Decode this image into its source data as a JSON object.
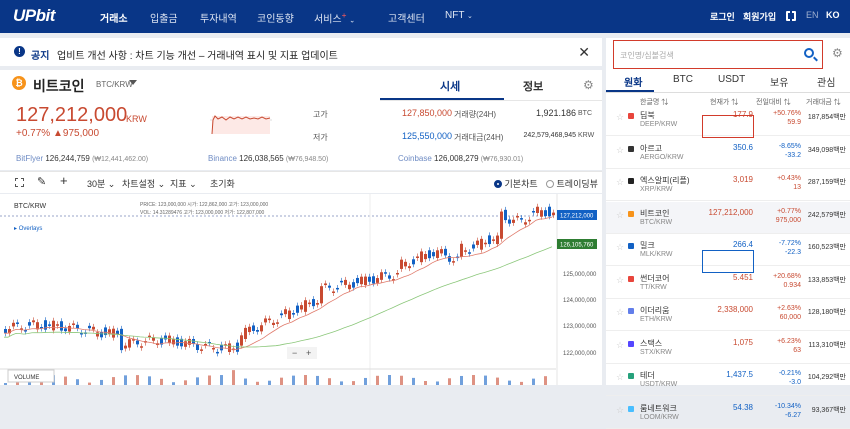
{
  "header": {
    "logo": "UPbit",
    "nav": [
      "거래소",
      "입출금",
      "투자내역",
      "코인동향",
      "서비스",
      "고객센터",
      "NFT"
    ],
    "service_plus": "+",
    "login": "로그인",
    "signup": "회원가입",
    "lang_en": "EN",
    "lang_ko": "KO"
  },
  "notice": {
    "label": "공지",
    "text": "업비트 개선 사항 : 차트 기능 개선 – 거래내역 표시 및 지표 업데이트"
  },
  "coin": {
    "name": "비트코인",
    "pair": "BTC/KRW",
    "tab_price": "시세",
    "tab_info": "정보",
    "price": "127,212,000",
    "unit": "KRW",
    "change_pct": "+0.77%",
    "change_amt": "▲975,000",
    "high_label": "고가",
    "high": "127,850,000",
    "low_label": "저가",
    "low": "125,550,000",
    "vol_label": "거래량(24H)",
    "vol": "1,921.186",
    "vol_unit": "BTC",
    "amt_label": "거래대금(24H)",
    "amt": "242,579,468,945",
    "amt_unit": "KRW",
    "ex1": "BitFlyer",
    "ex1_v": "126,244,759",
    "ex1_s": "(₩12,441,462.00)",
    "ex2": "Binance",
    "ex2_v": "126,038,565",
    "ex2_s": "(₩76,948.50)",
    "ex3": "Coinbase",
    "ex3_v": "126,008,279",
    "ex3_s": "(₩76,930.01)"
  },
  "toolbar": {
    "interval": "30분",
    "chart_settings": "차트설정",
    "indicator": "지표",
    "reset": "초기화",
    "basic": "기본차트",
    "tradingview": "트레이딩뷰"
  },
  "chart": {
    "symbol": "BTC/KRW",
    "overlays": "Overlays",
    "volume": "VOLUME",
    "ohlc": "PRICE: 123,000,000  시가: 122,862,000  고가: 123,000,000",
    "ohlc2": "VOL: 14.31289476  고가: 123,000,000  저가: 122,807,000",
    "tag1": "127,212,000",
    "tag2": "126,105,760",
    "ticks": [
      "125,000,000",
      "124,000,000",
      "123,000,000",
      "122,000,000"
    ],
    "colors": {
      "up": "#c84a31",
      "down": "#1261c4",
      "ma1": "#e07b6c",
      "ma2": "#8bc77a"
    }
  },
  "panel": {
    "search_placeholder": "코인명/심볼검색",
    "tabs": [
      "원화",
      "BTC",
      "USDT",
      "보유",
      "관심"
    ],
    "cols": [
      "한글명",
      "현재가",
      "전일대비",
      "거래대금"
    ],
    "rows": [
      {
        "name": "딥북",
        "pair": "DEEP/KRW",
        "price": "177.9",
        "pct": "+50.76%",
        "amt": "59.9",
        "vol": "187,854백만",
        "dir": "up",
        "color": "#e8453c"
      },
      {
        "name": "아르고",
        "pair": "AERGO/KRW",
        "price": "350.6",
        "pct": "-8.65%",
        "amt": "-33.2",
        "vol": "349,098백만",
        "dir": "dn",
        "color": "#333"
      },
      {
        "name": "엑스알피(리플)",
        "pair": "XRP/KRW",
        "price": "3,019",
        "pct": "+0.43%",
        "amt": "13",
        "vol": "287,159백만",
        "dir": "up",
        "color": "#222"
      },
      {
        "name": "비트코인",
        "pair": "BTC/KRW",
        "price": "127,212,000",
        "pct": "+0.77%",
        "amt": "975,000",
        "vol": "242,579백만",
        "dir": "up",
        "color": "#f7931a"
      },
      {
        "name": "밀크",
        "pair": "MLK/KRW",
        "price": "266.4",
        "pct": "-7.72%",
        "amt": "-22.3",
        "vol": "160,523백만",
        "dir": "dn",
        "color": "#1261c4"
      },
      {
        "name": "썬더코어",
        "pair": "TT/KRW",
        "price": "5.451",
        "pct": "+20.68%",
        "amt": "0.934",
        "vol": "133,853백만",
        "dir": "up",
        "color": "#e8453c"
      },
      {
        "name": "이더리움",
        "pair": "ETH/KRW",
        "price": "2,338,000",
        "pct": "+2.63%",
        "amt": "60,000",
        "vol": "128,180백만",
        "dir": "up",
        "color": "#627eea"
      },
      {
        "name": "스택스",
        "pair": "STX/KRW",
        "price": "1,075",
        "pct": "+6.23%",
        "amt": "63",
        "vol": "113,310백만",
        "dir": "up",
        "color": "#5546ff"
      },
      {
        "name": "테더",
        "pair": "USDT/KRW",
        "price": "1,437.5",
        "pct": "-0.21%",
        "amt": "-3.0",
        "vol": "104,292백만",
        "dir": "dn",
        "color": "#26a17b"
      },
      {
        "name": "룸네트워크",
        "pair": "LOOM/KRW",
        "price": "54.38",
        "pct": "-10.34%",
        "amt": "-6.27",
        "vol": "93,367백만",
        "dir": "dn",
        "color": "#48beff"
      }
    ]
  }
}
